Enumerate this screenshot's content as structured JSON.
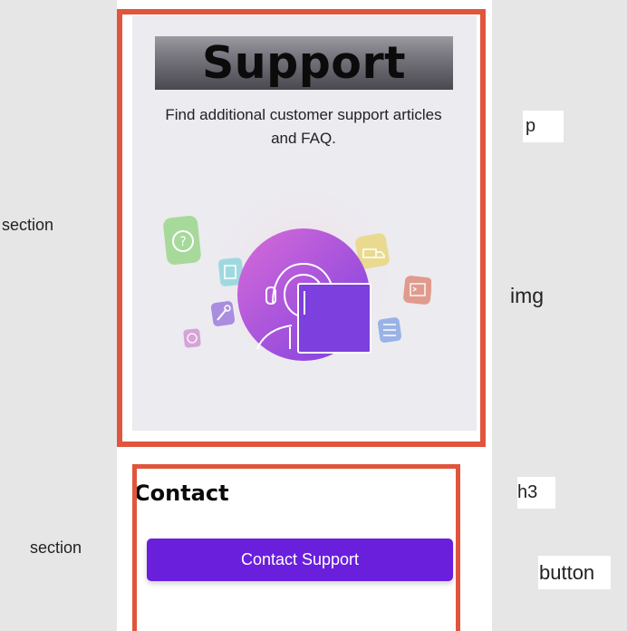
{
  "support": {
    "title": "Support",
    "description": "Find additional customer support articles and FAQ."
  },
  "contact": {
    "title": "Contact",
    "button_label": "Contact Support"
  },
  "annotations": {
    "section_top": "section",
    "section_bottom": "section",
    "p": "p",
    "img": "img",
    "h3": "h3",
    "button": "button"
  },
  "colors": {
    "accent": "#6a1fdc",
    "outline": "#e0553d",
    "card_bg": "#ecebf0"
  },
  "icons": [
    "question-icon",
    "file-icon",
    "truck-icon",
    "terminal-icon",
    "sliders-icon",
    "tool-icon",
    "fingerprint-icon",
    "headset-agent-icon"
  ]
}
